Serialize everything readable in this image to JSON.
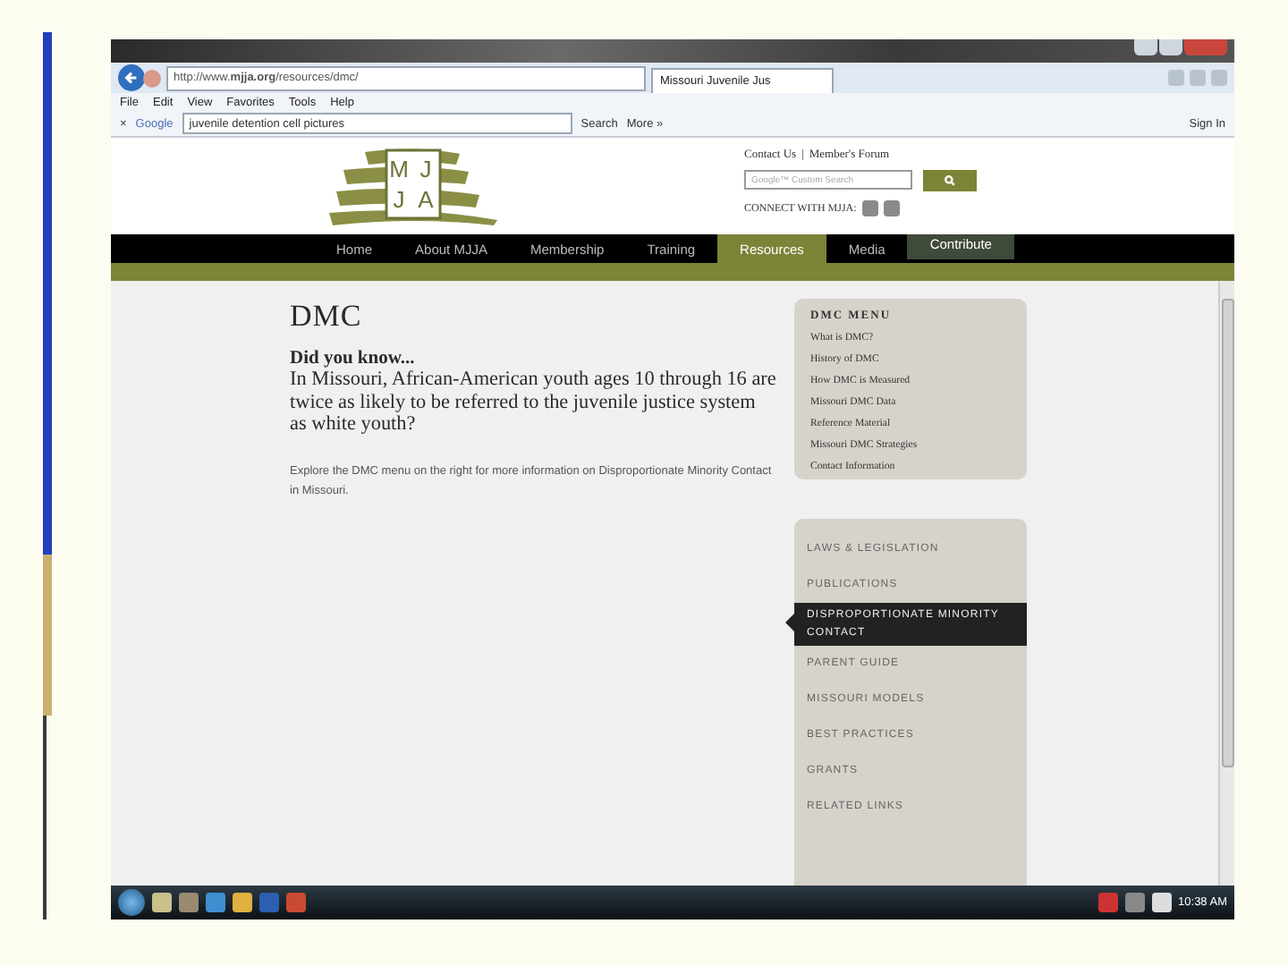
{
  "browser": {
    "address": "http://www.**mjja.org**/resources/dmc/",
    "tab_title": "Missouri Juvenile Jus",
    "menu": [
      "File",
      "Edit",
      "View",
      "Favorites",
      "Tools",
      "Help"
    ],
    "toolbar": {
      "close_mark": "×",
      "engine": "Google",
      "query": "juvenile detention cell pictures",
      "search_label": "Search",
      "more_label": "More »",
      "sign_in": "Sign In"
    }
  },
  "site": {
    "logo_letters": [
      "M",
      "J",
      "J",
      "A"
    ],
    "header_links": [
      "Contact Us",
      "Member's Forum"
    ],
    "header_separator": "|",
    "search_placeholder": "Google™ Custom Search",
    "connect_label": "CONNECT WITH MJJA:",
    "nav": [
      {
        "label": "Home",
        "kind": "link",
        "selected": false
      },
      {
        "label": "About MJJA",
        "kind": "link",
        "selected": false
      },
      {
        "label": "Membership",
        "kind": "link",
        "selected": false
      },
      {
        "label": "Training",
        "kind": "link",
        "selected": false
      },
      {
        "label": "Resources",
        "kind": "link",
        "selected": true
      },
      {
        "label": "Media",
        "kind": "link",
        "selected": false
      },
      {
        "label": "Contribute",
        "kind": "button",
        "selected": false
      }
    ]
  },
  "page": {
    "title": "DMC",
    "lead": "Did you know...",
    "question": "In Missouri, African-American youth ages 10 through 16 are twice as likely to be referred to the juvenile justice system as white youth?",
    "explore": "Explore the DMC menu on the right for more information on Disproportionate Minority Contact in Missouri.",
    "dmc_menu": {
      "title": "DMC MENU",
      "items": [
        "What is DMC?",
        "History of DMC",
        "How DMC is Measured",
        "Missouri DMC Data",
        "Reference Material",
        "Missouri DMC Strategies",
        "Contact Information"
      ]
    },
    "side_nav": [
      {
        "label": "LAWS & LEGISLATION",
        "selected": false
      },
      {
        "label": "PUBLICATIONS",
        "selected": false
      },
      {
        "label": "DISPROPORTIONATE MINORITY CONTACT",
        "selected": true
      },
      {
        "label": "PARENT GUIDE",
        "selected": false
      },
      {
        "label": "MISSOURI MODELS",
        "selected": false
      },
      {
        "label": "BEST PRACTICES",
        "selected": false
      },
      {
        "label": "GRANTS",
        "selected": false
      },
      {
        "label": "RELATED LINKS",
        "selected": false
      }
    ]
  },
  "taskbar": {
    "time": "10:38 AM"
  }
}
